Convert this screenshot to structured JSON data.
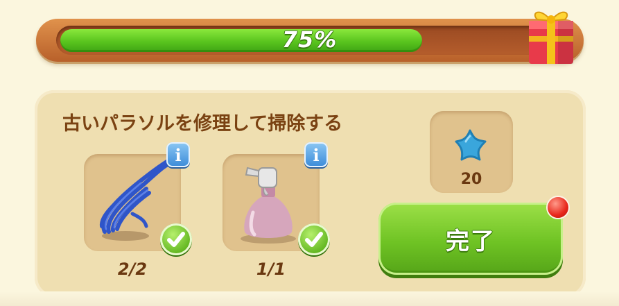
{
  "progress": {
    "percent_label": "75%",
    "value": 0.75
  },
  "task": {
    "title": "古いパラソルを修理して掃除する",
    "items": [
      {
        "icon": "rope-icon",
        "count": "2/2",
        "info": "i",
        "complete": true
      },
      {
        "icon": "spray-bottle-icon",
        "count": "1/1",
        "info": "i",
        "complete": true
      }
    ]
  },
  "reward": {
    "icon": "blue-star-icon",
    "amount": "20"
  },
  "complete_button": {
    "label": "完了"
  },
  "colors": {
    "accent_green": "#6fc324",
    "frame_orange": "#c8743a",
    "text_brown": "#7a4212"
  }
}
